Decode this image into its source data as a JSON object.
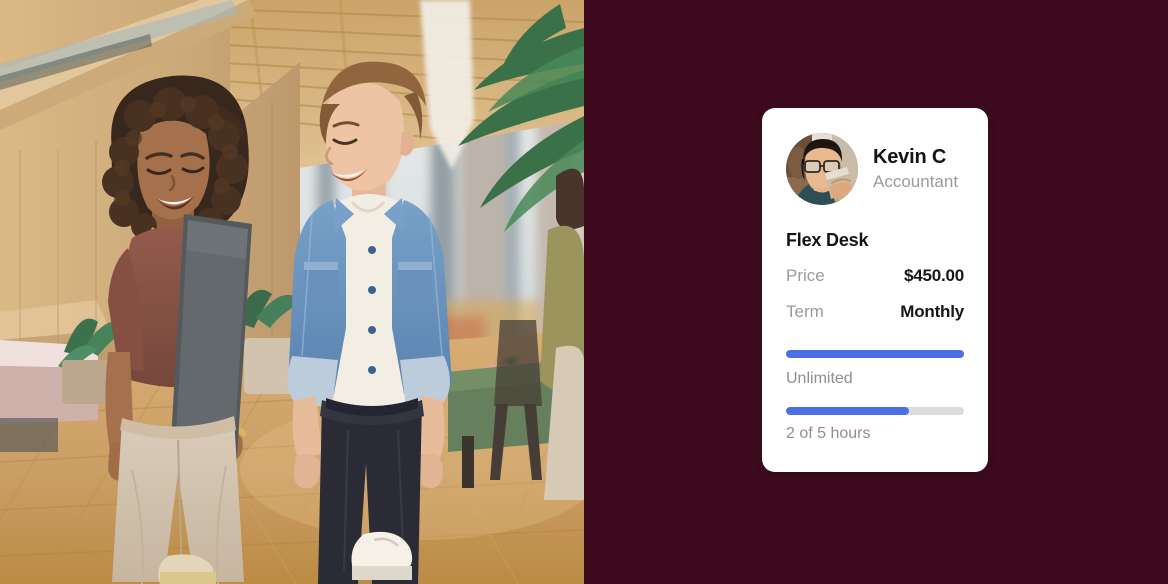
{
  "theme": {
    "background_color": "#3d0a1e",
    "card_color": "#ffffff",
    "accent_color": "#4c6fe6",
    "track_color": "#dcdcdc",
    "muted_text_color": "#9b9b9b",
    "strong_text_color": "#141414"
  },
  "photo": {
    "alt": "Two colleagues walking and smiling in a modern wooden coworking office lobby",
    "description": "woman in rust top holding a laptop beside a man in a denim shirt over a white tee"
  },
  "card": {
    "profile": {
      "avatar_alt": "Portrait of Kevin C wearing glasses and drinking from a takeaway coffee cup",
      "name": "Kevin C",
      "role": "Accountant"
    },
    "plan_title": "Flex Desk",
    "details": [
      {
        "label": "Price",
        "value": "$450.00"
      },
      {
        "label": "Term",
        "value": "Monthly"
      }
    ],
    "meters": [
      {
        "caption": "Unlimited",
        "percent": 100,
        "unlimited": true
      },
      {
        "caption": "2 of 5 hours",
        "percent": 69,
        "unlimited": false
      }
    ]
  }
}
